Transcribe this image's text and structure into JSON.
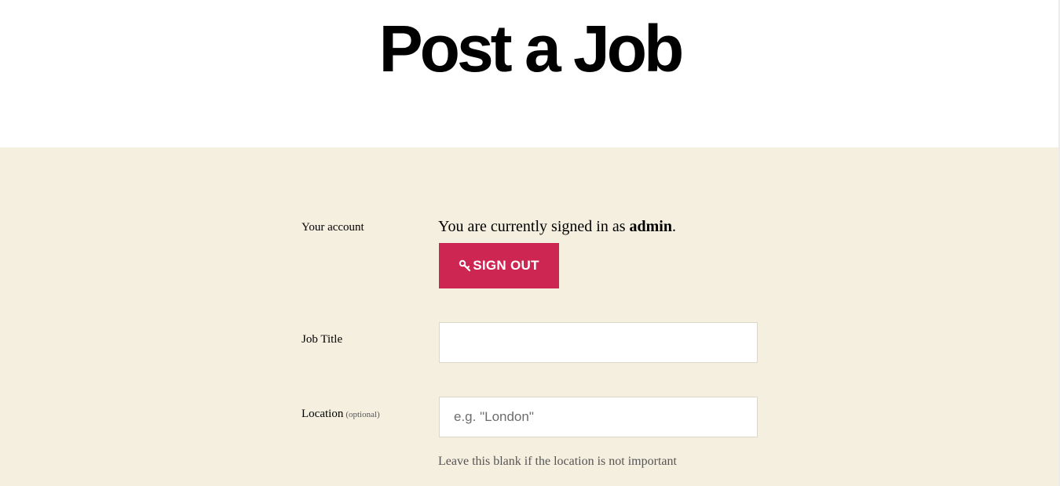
{
  "header": {
    "title": "Post a Job"
  },
  "account": {
    "label": "Your account",
    "signed_in_prefix": "You are currently signed in as ",
    "username": "admin",
    "signed_in_suffix": ".",
    "signout_label": "SIGN OUT",
    "signout_icon": "key-icon"
  },
  "job_title": {
    "label": "Job Title",
    "value": "",
    "placeholder": ""
  },
  "location": {
    "label": "Location",
    "optional_label": "(optional)",
    "value": "",
    "placeholder": "e.g. \"London\"",
    "help": "Leave this blank if the location is not important"
  },
  "colors": {
    "accent": "#cd2653",
    "section_background": "#f5efe0",
    "header_background": "#ffffff"
  }
}
